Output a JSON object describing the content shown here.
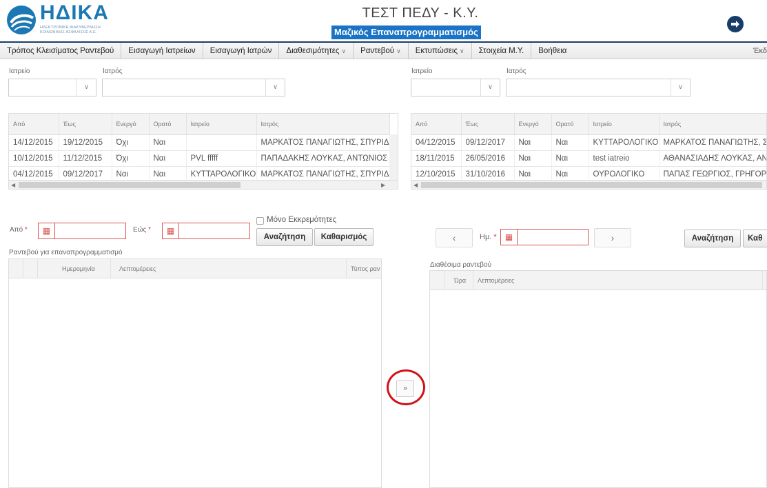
{
  "header": {
    "logo_brand": "ΗΔΙΚΑ",
    "logo_sub1": "ΗΛΕΚΤΡΟΝΙΚΗ ΔΙΑΚΥΒΕΡΝΗΣΗ",
    "logo_sub2": "ΚΟΙΝΩΝΙΚΗΣ ΑΣΦΑΛΙΣΗΣ Α.Ε.",
    "title": "ΤΕΣΤ ΠΕΔΥ - Κ.Υ.",
    "subtitle": "Μαζικός Επαναπρογραμματισμός",
    "logout_icon": "logout-arrow-icon"
  },
  "nav": {
    "items": [
      {
        "label": "Τρόπος Κλεισίματος Ραντεβού",
        "dropdown": false
      },
      {
        "label": "Εισαγωγή Ιατρείων",
        "dropdown": false
      },
      {
        "label": "Εισαγωγή Ιατρών",
        "dropdown": false
      },
      {
        "label": "Διαθεσιμότητες",
        "dropdown": true
      },
      {
        "label": "Ραντεβού",
        "dropdown": true
      },
      {
        "label": "Εκτυπώσεις",
        "dropdown": true
      },
      {
        "label": "Στοιχεία Μ.Υ.",
        "dropdown": false
      },
      {
        "label": "Βοήθεια",
        "dropdown": false
      }
    ],
    "right_text": "Έκδ"
  },
  "left": {
    "filter": {
      "clinic_label": "Ιατρείο",
      "doctor_label": "Ιατρός"
    },
    "table": {
      "columns": [
        "Από",
        "Έως",
        "Ενεργό",
        "Ορατό",
        "Ιατρείο",
        "Ιατρός"
      ],
      "rows": [
        [
          "14/12/2015",
          "19/12/2015",
          "Όχι",
          "Ναι",
          "",
          "ΜΑΡΚΑΤΟΣ ΠΑΝΑΓΙΩΤΗΣ, ΣΠΥΡΙΔΩ"
        ],
        [
          "10/12/2015",
          "11/12/2015",
          "Όχι",
          "Ναι",
          "PVL fffff",
          "ΠΑΠΑΔΑΚΗΣ ΛΟΥΚΑΣ, ΑΝΤΩΝΙΟΣ"
        ],
        [
          "04/12/2015",
          "09/12/2017",
          "Ναι",
          "Ναι",
          "ΚΥΤΤΑΡΟΛΟΓΙΚΟ",
          "ΜΑΡΚΑΤΟΣ ΠΑΝΑΓΙΩΤΗΣ, ΣΠΥΡΙΔΩ"
        ]
      ]
    },
    "from_label": "Από",
    "to_label": "Εώς",
    "pending_only_label": "Μόνο Εκκρεμότητες",
    "search_label": "Αναζήτηση",
    "clear_label": "Καθαρισμός",
    "appointments_title": "Ραντεβού για επαναπρογραμματισμό",
    "appointments_columns": [
      "Ημερομηνία",
      "Λεπτομέρειες",
      "Τύπος ραν"
    ]
  },
  "right": {
    "filter": {
      "clinic_label": "Ιατρείο",
      "doctor_label": "Ιατρός"
    },
    "table": {
      "columns": [
        "Από",
        "Έως",
        "Ενεργό",
        "Ορατό",
        "Ιατρείο",
        "Ιατρός"
      ],
      "rows": [
        [
          "04/12/2015",
          "09/12/2017",
          "Ναι",
          "Ναι",
          "ΚΥΤΤΑΡΟΛΟΓΙΚΟ",
          "ΜΑΡΚΑΤΟΣ ΠΑΝΑΓΙΩΤΗΣ, ΣΠ"
        ],
        [
          "18/11/2015",
          "26/05/2016",
          "Ναι",
          "Ναι",
          "test iatreio",
          "ΑΘΑΝΑΣΙΑΔΗΣ ΛΟΥΚΑΣ, ΑΝΤ"
        ],
        [
          "12/10/2015",
          "31/10/2016",
          "Ναι",
          "Ναι",
          "ΟΥΡΟΛΟΓΙΚΟ",
          "ΠΑΠΑΣ ΓΕΩΡΓΙΟΣ, ΓΡΗΓΟΡ"
        ]
      ]
    },
    "prev_label": "‹",
    "next_label": "›",
    "date_label": "Ημ.",
    "search_label": "Αναζήτηση",
    "clear_label": "Καθ",
    "available_title": "Διαθέσιμα ραντεβού",
    "available_columns": [
      "Ώρα",
      "Λεπτομέρειες"
    ]
  },
  "transfer_label": "»",
  "colors": {
    "accent": "#1a73c4",
    "nav_border": "#1a3c6a",
    "required": "#d9534f",
    "highlight": "#d0121b"
  }
}
